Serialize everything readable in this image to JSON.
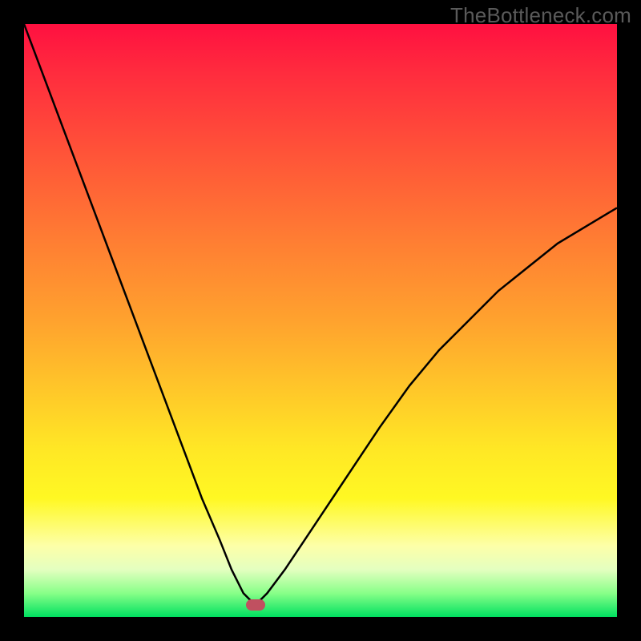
{
  "watermark": "TheBottleneck.com",
  "chart_data": {
    "type": "line",
    "title": "",
    "xlabel": "",
    "ylabel": "",
    "xlim": [
      0,
      100
    ],
    "ylim": [
      0,
      100
    ],
    "grid": false,
    "legend": false,
    "notes": "Two curve branches forming a V; minimum near x≈39 touches baseline. Background gradient red(top)→green(bottom). Rounded marker at the minimum.",
    "marker": {
      "x": 39,
      "y": 2,
      "shape": "rounded-rect",
      "color": "#c05060"
    },
    "series": [
      {
        "name": "left-branch",
        "x": [
          0,
          3,
          6,
          9,
          12,
          15,
          18,
          21,
          24,
          27,
          30,
          33,
          35,
          37,
          39
        ],
        "y": [
          100,
          92,
          84,
          76,
          68,
          60,
          52,
          44,
          36,
          28,
          20,
          13,
          8,
          4,
          2
        ]
      },
      {
        "name": "right-branch",
        "x": [
          39,
          41,
          44,
          48,
          52,
          56,
          60,
          65,
          70,
          75,
          80,
          85,
          90,
          95,
          100
        ],
        "y": [
          2,
          4,
          8,
          14,
          20,
          26,
          32,
          39,
          45,
          50,
          55,
          59,
          63,
          66,
          69
        ]
      }
    ]
  },
  "colors": {
    "curve": "#000000",
    "frame": "#000000",
    "marker": "#c05060"
  }
}
